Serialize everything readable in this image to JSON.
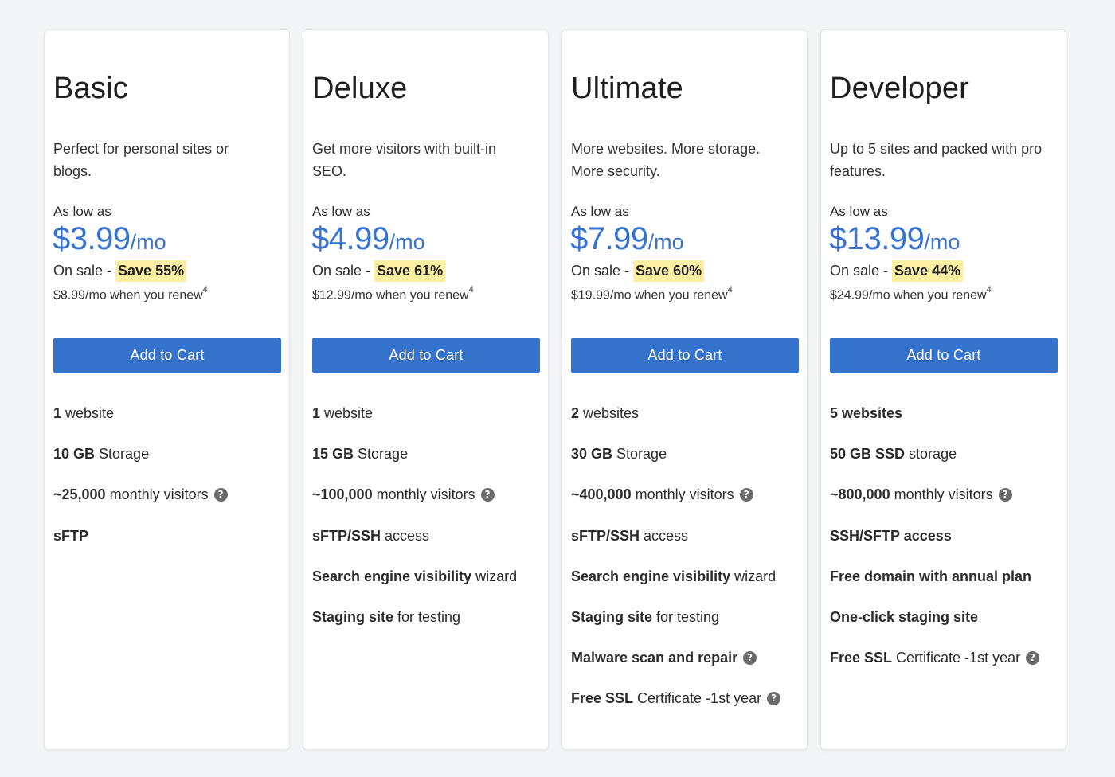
{
  "plans": [
    {
      "name": "Basic",
      "description": "Perfect for personal sites or blogs.",
      "as_low_as": "As low as",
      "price": "$3.99",
      "per": "/mo",
      "on_sale": "On sale -",
      "save": "Save 55%",
      "renew": "$8.99/mo when you renew",
      "renew_sup": "4",
      "button": "Add to Cart",
      "features": [
        {
          "bold": "1",
          "text": " website",
          "help": false
        },
        {
          "bold": "10 GB",
          "text": " Storage",
          "help": false
        },
        {
          "bold": "~25,000",
          "text": " monthly visitors",
          "help": true
        },
        {
          "bold": "sFTP",
          "text": "",
          "help": false
        }
      ]
    },
    {
      "name": "Deluxe",
      "description": "Get more visitors with built-in SEO.",
      "as_low_as": "As low as",
      "price": "$4.99",
      "per": "/mo",
      "on_sale": "On sale -",
      "save": "Save 61%",
      "renew": "$12.99/mo when you renew",
      "renew_sup": "4",
      "button": "Add to Cart",
      "features": [
        {
          "bold": "1",
          "text": " website",
          "help": false
        },
        {
          "bold": "15 GB",
          "text": " Storage",
          "help": false
        },
        {
          "bold": "~100,000",
          "text": " monthly visitors",
          "help": true
        },
        {
          "bold": "sFTP/SSH",
          "text": " access",
          "help": false
        },
        {
          "bold": "Search engine visibility",
          "text": " wizard",
          "help": false
        },
        {
          "bold": "Staging site",
          "text": " for testing",
          "help": false
        }
      ]
    },
    {
      "name": "Ultimate",
      "description": "More websites. More storage. More security.",
      "as_low_as": "As low as",
      "price": "$7.99",
      "per": "/mo",
      "on_sale": "On sale -",
      "save": "Save 60%",
      "renew": "$19.99/mo when you renew",
      "renew_sup": "4",
      "button": "Add to Cart",
      "features": [
        {
          "bold": "2",
          "text": " websites",
          "help": false
        },
        {
          "bold": "30 GB",
          "text": " Storage",
          "help": false
        },
        {
          "bold": "~400,000",
          "text": " monthly visitors",
          "help": true
        },
        {
          "bold": "sFTP/SSH",
          "text": " access",
          "help": false
        },
        {
          "bold": "Search engine visibility",
          "text": " wizard",
          "help": false
        },
        {
          "bold": "Staging site",
          "text": " for testing",
          "help": false
        },
        {
          "bold": "Malware scan and repair",
          "text": "",
          "help": true
        },
        {
          "bold": "Free SSL",
          "text": " Certificate -1st year",
          "help": true
        }
      ]
    },
    {
      "name": "Developer",
      "description": "Up to 5 sites and packed with pro features.",
      "as_low_as": "As low as",
      "price": "$13.99",
      "per": "/mo",
      "on_sale": "On sale -",
      "save": "Save 44%",
      "renew": "$24.99/mo when you renew",
      "renew_sup": "4",
      "button": "Add to Cart",
      "features": [
        {
          "bold": "5 websites",
          "text": "",
          "help": false
        },
        {
          "bold": "50 GB SSD",
          "text": " storage",
          "help": false
        },
        {
          "bold": "~800,000",
          "text": " monthly visitors",
          "help": true
        },
        {
          "bold": "SSH/SFTP access",
          "text": "",
          "help": false
        },
        {
          "bold": "Free domain with annual plan",
          "text": "",
          "help": false
        },
        {
          "bold": "One-click staging site",
          "text": "",
          "help": false
        },
        {
          "bold": "Free SSL",
          "text": " Certificate -1st year",
          "help": true
        }
      ]
    }
  ],
  "icons": {
    "help": "question-mark-icon",
    "help_glyph": "?"
  },
  "colors": {
    "price": "#3773d0",
    "button": "#3472cc",
    "save_highlight": "#fcefa1",
    "background": "#f3f5f6"
  }
}
